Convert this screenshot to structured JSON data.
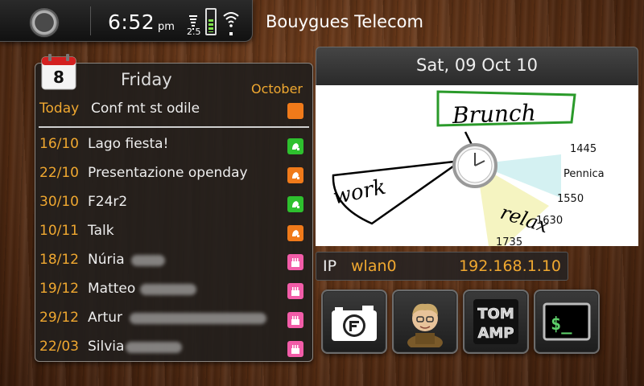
{
  "status_bar": {
    "time": "6:52",
    "ampm": "pm",
    "signal_label": "2.5",
    "operator": "Bouygues Telecom",
    "icons": [
      "home-icon",
      "signal-icon",
      "battery-icon",
      "wifi-icon"
    ]
  },
  "calendar": {
    "day_number": "8",
    "day_name": "Friday",
    "month": "October",
    "today_label": "Today",
    "today_title": "Conf mt st odile",
    "today_badge": "orange",
    "events": [
      {
        "date": "16/10",
        "title": "Lago fiesta!",
        "badge": "green"
      },
      {
        "date": "22/10",
        "title": "Presentazione openday",
        "badge": "orange"
      },
      {
        "date": "30/10",
        "title": "F24r2",
        "badge": "green"
      },
      {
        "date": "10/11",
        "title": "Talk",
        "badge": "orange"
      },
      {
        "date": "18/12",
        "title": "Núria",
        "badge": "pink"
      },
      {
        "date": "19/12",
        "title": "Matteo",
        "badge": "pink"
      },
      {
        "date": "29/12",
        "title": "Artur",
        "badge": "pink"
      },
      {
        "date": "22/03",
        "title": "Silvia",
        "badge": "pink"
      }
    ]
  },
  "date_header": "Sat, 09 Oct 10",
  "canvas": {
    "labels": [
      "1445",
      "Pennica",
      "1550",
      "1630",
      "1735"
    ],
    "handwriting": [
      "Brunch",
      "work",
      "relax"
    ]
  },
  "network": {
    "ip_label": "IP",
    "interface": "wlan0",
    "address": "192.168.1.10"
  },
  "apps": [
    {
      "name": "camera",
      "icon": "camera-icon"
    },
    {
      "name": "avatar",
      "icon": "avatar-icon"
    },
    {
      "name": "tomamp",
      "icon": "tomamp-icon",
      "text": "TOM AMP"
    },
    {
      "name": "terminal",
      "icon": "terminal-icon",
      "text": "$_"
    }
  ],
  "colors": {
    "accent": "#f0a830",
    "badge_orange": "#f07a1a",
    "badge_green": "#2ec02e",
    "badge_pink": "#f25ca8"
  }
}
